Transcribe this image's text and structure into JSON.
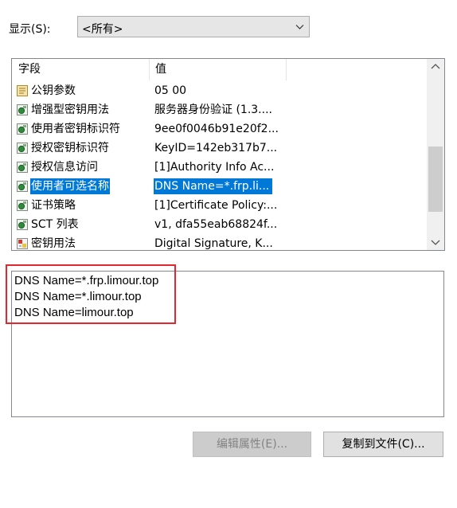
{
  "show": {
    "label": "显示(S):",
    "selected": "<所有>"
  },
  "list": {
    "columns": [
      "字段",
      "值"
    ],
    "rows": [
      {
        "field": "公钥参数",
        "value": "05 00",
        "icon": "certificate-field-icon",
        "selected": false
      },
      {
        "field": "增强型密钥用法",
        "value": "服务器身份验证 (1.3....",
        "icon": "certificate-extension-icon",
        "selected": false
      },
      {
        "field": "使用者密钥标识符",
        "value": "9ee0f0046b91e20f2...",
        "icon": "certificate-extension-icon",
        "selected": false
      },
      {
        "field": "授权密钥标识符",
        "value": "KeyID=142eb317b7...",
        "icon": "certificate-extension-icon",
        "selected": false
      },
      {
        "field": "授权信息访问",
        "value": "[1]Authority Info Ac...",
        "icon": "certificate-extension-icon",
        "selected": false
      },
      {
        "field": "使用者可选名称",
        "value": "DNS Name=*.frp.li...",
        "icon": "certificate-extension-icon",
        "selected": true
      },
      {
        "field": "证书策略",
        "value": "[1]Certificate Policy:...",
        "icon": "certificate-extension-icon",
        "selected": false
      },
      {
        "field": "SCT 列表",
        "value": "v1, dfa55eab68824f...",
        "icon": "certificate-extension-icon",
        "selected": false
      },
      {
        "field": "密钥用法",
        "value": "Digital Signature, K...",
        "icon": "certificate-critical-extension-icon",
        "selected": false
      }
    ]
  },
  "detail": {
    "lines": [
      "DNS Name=*.frp.limour.top",
      "DNS Name=*.limour.top",
      "DNS Name=limour.top"
    ]
  },
  "buttons": {
    "edit": "编辑属性(E)...",
    "copy": "复制到文件(C)..."
  },
  "colors": {
    "selection": "#0078d7",
    "highlight_box": "#e0282e"
  }
}
